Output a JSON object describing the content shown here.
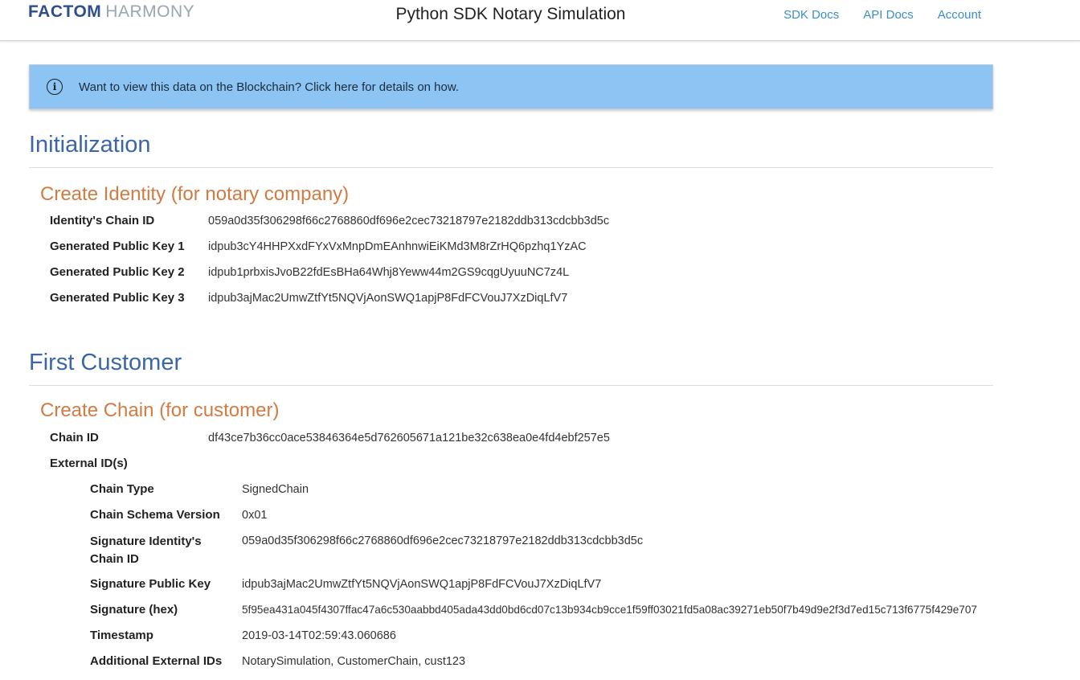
{
  "header": {
    "brand_bold": "FACTOM",
    "brand_light": "HARMONY",
    "title": "Python SDK Notary Simulation",
    "nav": [
      "SDK Docs",
      "API Docs",
      "Account"
    ]
  },
  "banner": {
    "text": "Want to view this data on the Blockchain? Click here for details on how.",
    "icon": "info-icon",
    "color": "#8cc4f4"
  },
  "initialization": {
    "title": "Initialization",
    "create_identity": {
      "title": "Create Identity (for notary company)",
      "rows": [
        {
          "label": "Identity's Chain ID",
          "value": "059a0d35f306298f66c2768860df696e2cec73218797e2182ddb313cdcbb3d5c"
        },
        {
          "label": "Generated Public Key 1",
          "value": "idpub3cY4HHPXxdFYxVxMnpDmEAnhnwiEiKMd3M8rZrHQ6pzhq1YzAC"
        },
        {
          "label": "Generated Public Key 2",
          "value": "idpub1prbxisJvoB22fdEsBHa64Whj8Yeww44m2GS9cqgUyuuNC7z4L"
        },
        {
          "label": "Generated Public Key 3",
          "value": "idpub3ajMac2UmwZtfYt5NQVjAonSWQ1apjP8FdFCVouJ7XzDiqLfV7"
        }
      ]
    }
  },
  "first_customer": {
    "title": "First Customer",
    "create_chain": {
      "title": "Create Chain (for customer)",
      "chain_id_label": "Chain ID",
      "chain_id_value": "df43ce7b36cc0ace53846364e5d762605671a121be32c638ea0e4fd4ebf257e5",
      "external_ids_label": "External ID(s)",
      "external_ids": [
        {
          "label": "Chain Type",
          "value": "SignedChain"
        },
        {
          "label": "Chain Schema Version",
          "value": "0x01"
        },
        {
          "label": "Signature Identity's Chain ID",
          "value": "059a0d35f306298f66c2768860df696e2cec73218797e2182ddb313cdcbb3d5c"
        },
        {
          "label": "Signature Public Key",
          "value": "idpub3ajMac2UmwZtfYt5NQVjAonSWQ1apjP8FdFCVouJ7XzDiqLfV7"
        },
        {
          "label": "Signature (hex)",
          "value": "5f95ea431a045f4307ffac47a6c530aabbd405ada43dd0bd6cd07c13b934cb9cce1f59ff03021fd5a08ac39271eb50f7b49d9e2f3d7ed15c713f6775f429e707"
        },
        {
          "label": "Timestamp",
          "value": "2019-03-14T02:59:43.060686"
        },
        {
          "label": "Additional External IDs",
          "value": "NotarySimulation, CustomerChain, cust123"
        }
      ]
    }
  },
  "colors": {
    "brand": "#2f4f8a",
    "link": "#3a8ec9",
    "section_title": "#3b66a8",
    "sub_title": "#d27b43"
  }
}
